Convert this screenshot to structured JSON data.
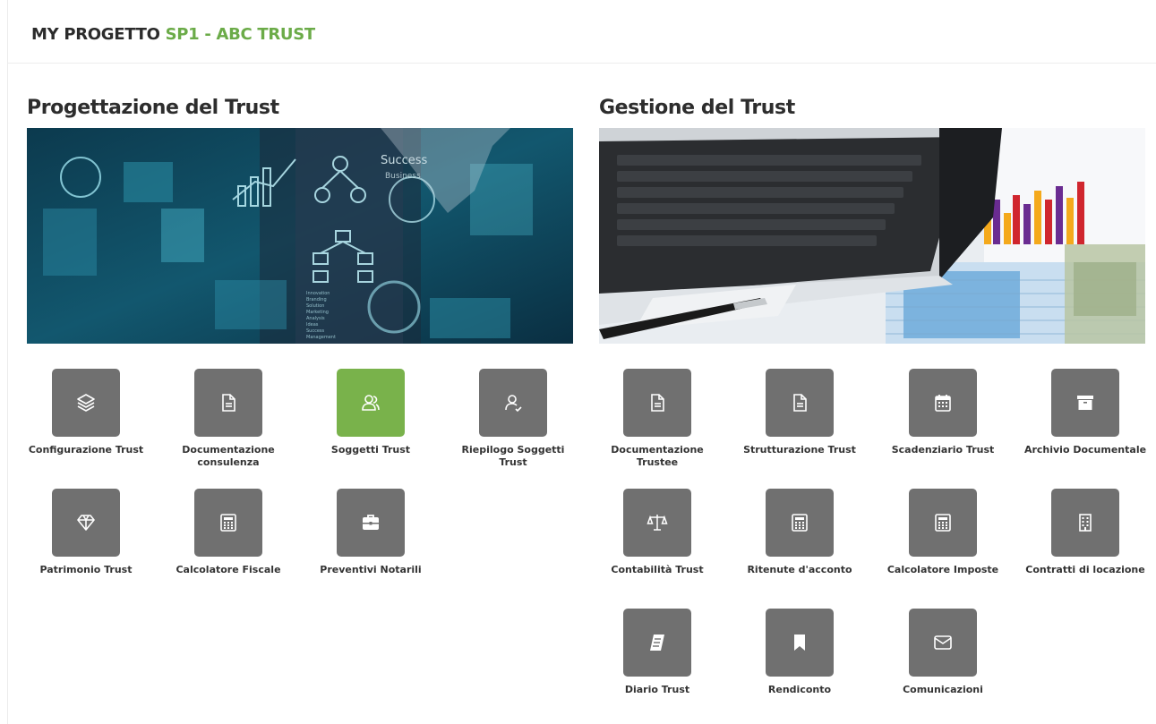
{
  "header": {
    "prefix": "MY PROGETTO",
    "project": "SP1 - ABC TRUST"
  },
  "left": {
    "title": "Progettazione del Trust",
    "banner_texts": [
      "Success",
      "Business",
      "Innovation",
      "Branding",
      "Solution",
      "Marketing",
      "Analysis",
      "Ideas",
      "Success",
      "Management"
    ],
    "tiles": [
      {
        "label": "Configurazione Trust",
        "icon": "layers-icon"
      },
      {
        "label": "Documentazione consulenza",
        "icon": "document-icon"
      },
      {
        "label": "Soggetti Trust",
        "icon": "users-icon",
        "active": true
      },
      {
        "label": "Riepilogo Soggetti Trust",
        "icon": "user-check-icon"
      },
      {
        "label": "Patrimonio Trust",
        "icon": "diamond-icon"
      },
      {
        "label": "Calcolatore Fiscale",
        "icon": "calculator-icon"
      },
      {
        "label": "Preventivi Notarili",
        "icon": "briefcase-icon"
      }
    ]
  },
  "right": {
    "title": "Gestione del Trust",
    "tiles": [
      {
        "label": "Documentazione Trustee",
        "icon": "document-icon"
      },
      {
        "label": "Strutturazione Trust",
        "icon": "document-icon"
      },
      {
        "label": "Scadenziario Trust",
        "icon": "calendar-icon"
      },
      {
        "label": "Archivio Documentale",
        "icon": "archive-icon"
      },
      {
        "label": "Contabilità Trust",
        "icon": "balance-scale-icon"
      },
      {
        "label": "Ritenute d'acconto",
        "icon": "calculator-icon"
      },
      {
        "label": "Calcolatore Imposte",
        "icon": "calculator-icon"
      },
      {
        "label": "Contratti di locazione",
        "icon": "building-icon"
      },
      {
        "label": "Diario Trust",
        "icon": "book-icon"
      },
      {
        "label": "Rendiconto",
        "icon": "bookmark-icon"
      },
      {
        "label": "Comunicazioni",
        "icon": "envelope-icon"
      }
    ]
  },
  "colors": {
    "accent": "#79b24b",
    "tile": "#707070",
    "title_accent": "#6bab48"
  }
}
